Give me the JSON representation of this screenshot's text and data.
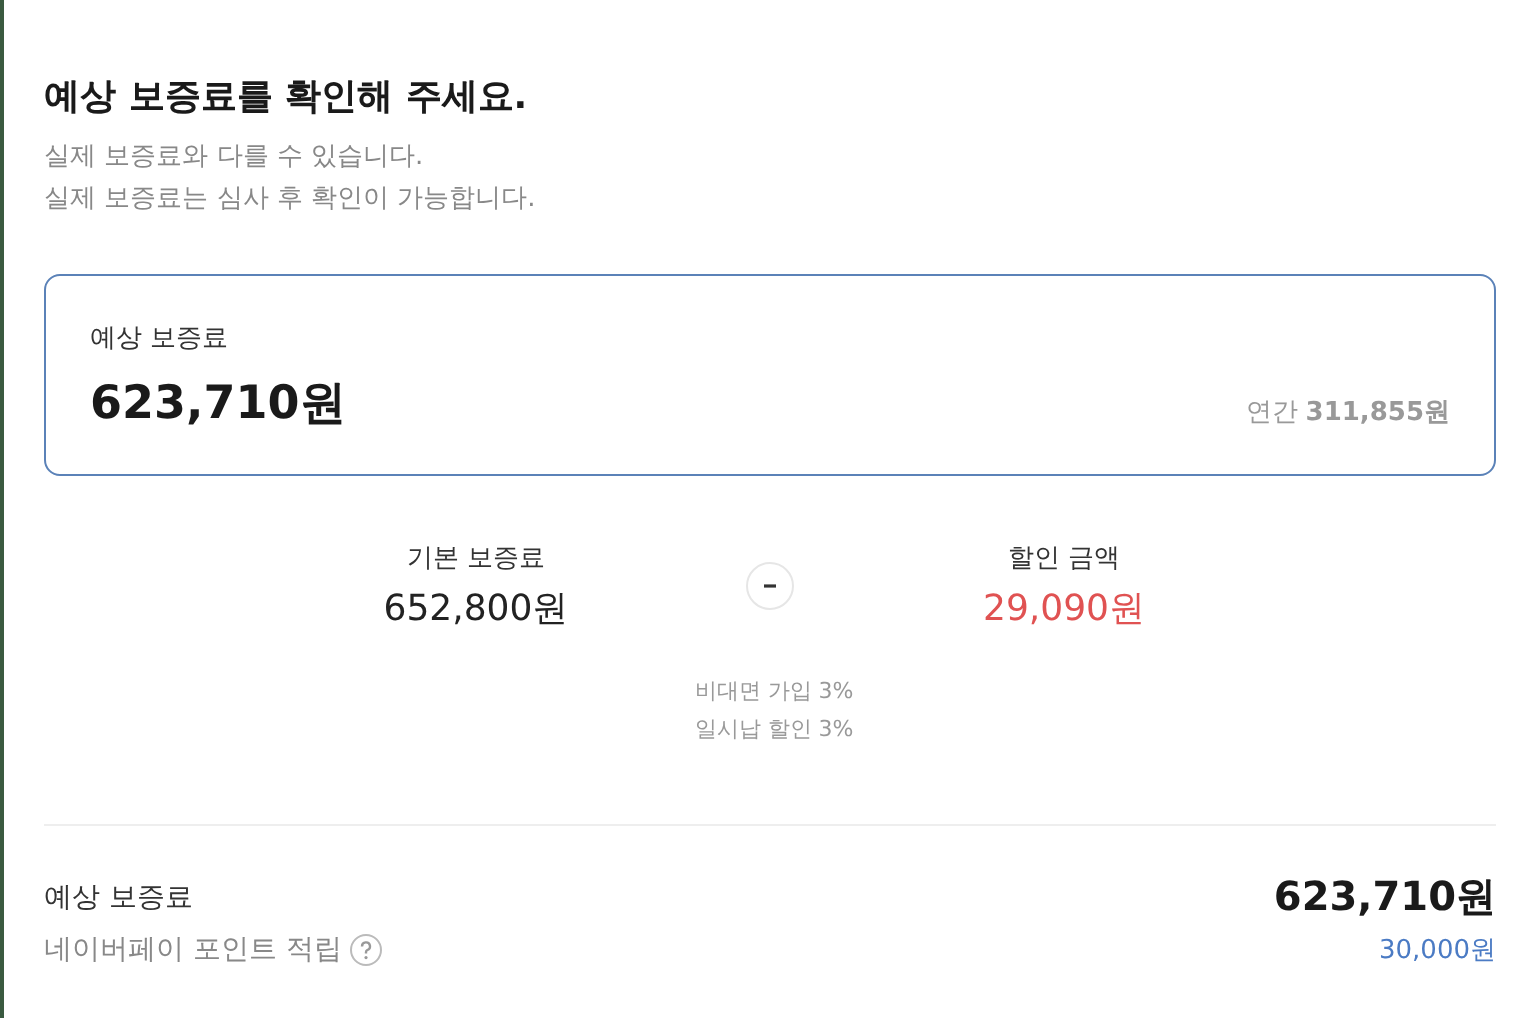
{
  "header": {
    "title": "예상 보증료를 확인해 주세요.",
    "notes": [
      "실제 보증료와 다를 수 있습니다.",
      "실제 보증료는 심사 후 확인이 가능합니다."
    ]
  },
  "estimate_card": {
    "label": "예상 보증료",
    "amount": "623,710원",
    "annual_label": "연간",
    "annual_amount": "311,855원"
  },
  "breakdown": {
    "base": {
      "label": "기본 보증료",
      "amount": "652,800원"
    },
    "discount": {
      "label": "할인 금액",
      "amount": "29,090원"
    },
    "discount_items": [
      "비대면 가입 3%",
      "일시납 할인 3%"
    ]
  },
  "summary": {
    "label": "예상 보증료",
    "amount": "623,710원",
    "points_label": "네이버페이 포인트 적립",
    "points_amount": "30,000원"
  }
}
